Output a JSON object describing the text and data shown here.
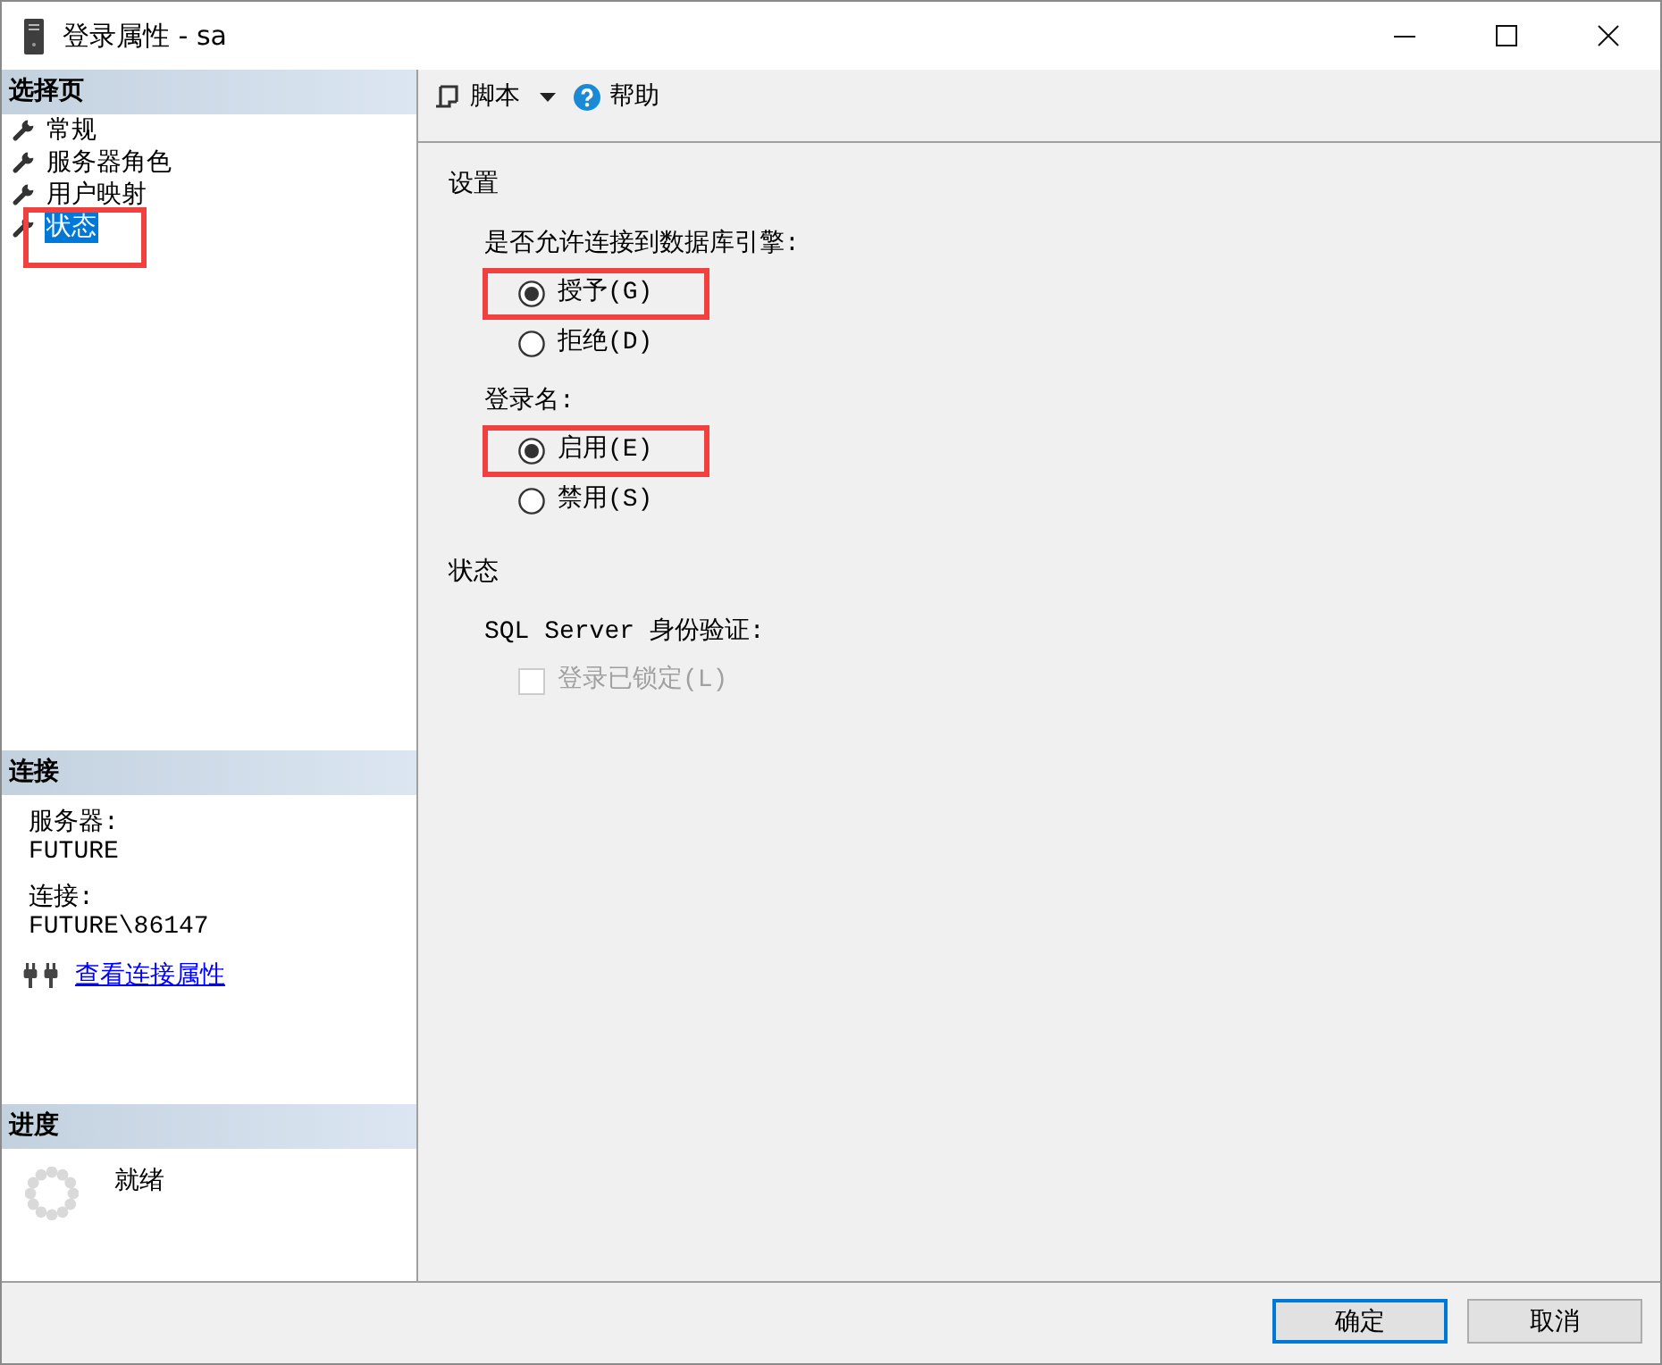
{
  "window": {
    "title": "登录属性 - sa"
  },
  "select_page": {
    "title": "选择页",
    "items": [
      {
        "label": "常规",
        "selected": false,
        "highlighted": false
      },
      {
        "label": "服务器角色",
        "selected": false,
        "highlighted": false
      },
      {
        "label": "用户映射",
        "selected": false,
        "highlighted": false
      },
      {
        "label": "状态",
        "selected": true,
        "highlighted": true
      }
    ]
  },
  "connection": {
    "title": "连接",
    "fields": [
      {
        "label": "服务器:",
        "value": "FUTURE"
      },
      {
        "label": "连接:",
        "value": "FUTURE\\86147"
      }
    ],
    "link": "查看连接属性"
  },
  "progress": {
    "title": "进度",
    "status": "就绪"
  },
  "toolbar": {
    "script": "脚本",
    "help": "帮助"
  },
  "sections": [
    {
      "title": "设置",
      "groups": [
        {
          "label": "是否允许连接到数据库引擎:",
          "options": [
            {
              "kind": "radio",
              "label": "授予(G)",
              "selected": true,
              "highlighted": true
            },
            {
              "kind": "radio",
              "label": "拒绝(D)",
              "selected": false,
              "highlighted": false
            }
          ]
        },
        {
          "label": "登录名:",
          "options": [
            {
              "kind": "radio",
              "label": "启用(E)",
              "selected": true,
              "highlighted": true
            },
            {
              "kind": "radio",
              "label": "禁用(S)",
              "selected": false,
              "highlighted": false
            }
          ]
        }
      ]
    },
    {
      "title": "状态",
      "groups": [
        {
          "label": "SQL Server 身份验证:",
          "options": [
            {
              "kind": "checkbox",
              "label": "登录已锁定(L)",
              "checked": false,
              "disabled": true
            }
          ]
        }
      ]
    }
  ],
  "buttons": [
    {
      "label": "确定",
      "default": true
    },
    {
      "label": "取消",
      "default": false
    }
  ]
}
